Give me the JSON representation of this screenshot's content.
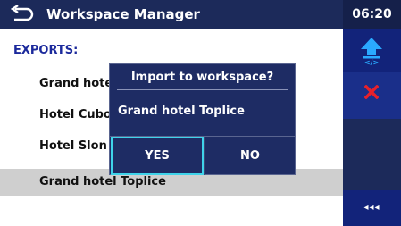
{
  "header": {
    "title": "Workspace Manager",
    "time": "06:20"
  },
  "list": {
    "section_label": "EXPORTS:",
    "items": [
      {
        "label": "Grand hotel Toplice"
      },
      {
        "label": "Hotel Cubo"
      },
      {
        "label": "Hotel Slon"
      },
      {
        "label": "Grand hotel Toplice"
      }
    ],
    "selected_index": 3
  },
  "dialog": {
    "title": "Import to workspace?",
    "message": "Grand hotel Toplice",
    "yes_label": "YES",
    "no_label": "NO"
  },
  "side_panel": {
    "buttons": [
      {
        "icon": "upload-arrow-icon"
      },
      {
        "icon": "delete-x-icon"
      },
      {
        "icon": "more-options-icon",
        "label": "◂◂◂"
      }
    ]
  },
  "colors": {
    "header_bg": "#1c2a5a",
    "panel_bg": "#1c2a5a",
    "section_blue": "#1c2a9c",
    "selected_row": "#cfcfcf",
    "focus_border": "#3fd3ea",
    "delete_red": "#e8202a"
  }
}
